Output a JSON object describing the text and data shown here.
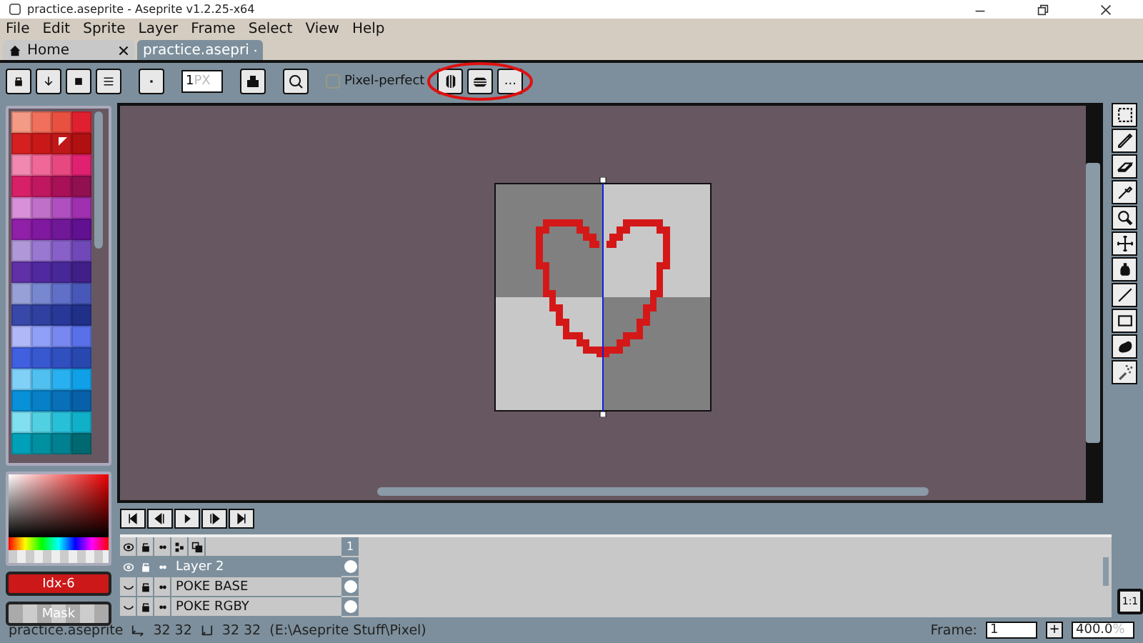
{
  "window": {
    "title": "practice.aseprite - Aseprite v1.2.25-x64"
  },
  "menu": [
    "File",
    "Edit",
    "Sprite",
    "Layer",
    "Frame",
    "Select",
    "View",
    "Help"
  ],
  "tabs": [
    {
      "label": "Home",
      "selected": false,
      "modified": false
    },
    {
      "label": "practice.asepri",
      "selected": true,
      "modified": true
    }
  ],
  "toolbar": {
    "brush_size": {
      "value": "1",
      "unit": "PX"
    },
    "pixel_perfect": {
      "label": "Pixel-perfect",
      "checked": false
    },
    "more": "..."
  },
  "palette": [
    {
      "color": "#f59a84",
      "selected": false
    },
    {
      "color": "#f0705c",
      "selected": false
    },
    {
      "color": "#e8503f",
      "selected": false
    },
    {
      "color": "#e02030",
      "selected": false
    },
    {
      "color": "#d42020",
      "selected": false
    },
    {
      "color": "#c81818",
      "selected": false
    },
    {
      "color": "#c01818",
      "selected": true
    },
    {
      "color": "#b01010",
      "selected": false
    },
    {
      "color": "#f088b0",
      "selected": false
    },
    {
      "color": "#f06898",
      "selected": false
    },
    {
      "color": "#e84880",
      "selected": false
    },
    {
      "color": "#e02070",
      "selected": false
    },
    {
      "color": "#d82068",
      "selected": false
    },
    {
      "color": "#c01860",
      "selected": false
    },
    {
      "color": "#a81058",
      "selected": false
    },
    {
      "color": "#901050",
      "selected": false
    },
    {
      "color": "#d890d8",
      "selected": false
    },
    {
      "color": "#c070c8",
      "selected": false
    },
    {
      "color": "#b050c0",
      "selected": false
    },
    {
      "color": "#a030b0",
      "selected": false
    },
    {
      "color": "#9020a8",
      "selected": false
    },
    {
      "color": "#8018a0",
      "selected": false
    },
    {
      "color": "#701898",
      "selected": false
    },
    {
      "color": "#601090",
      "selected": false
    },
    {
      "color": "#b098d8",
      "selected": false
    },
    {
      "color": "#9878d0",
      "selected": false
    },
    {
      "color": "#8860c8",
      "selected": false
    },
    {
      "color": "#7048b8",
      "selected": false
    },
    {
      "color": "#6030a8",
      "selected": false
    },
    {
      "color": "#5028a0",
      "selected": false
    },
    {
      "color": "#482898",
      "selected": false
    },
    {
      "color": "#402088",
      "selected": false
    },
    {
      "color": "#98a0d8",
      "selected": false
    },
    {
      "color": "#7888d0",
      "selected": false
    },
    {
      "color": "#6070c8",
      "selected": false
    },
    {
      "color": "#4858b8",
      "selected": false
    },
    {
      "color": "#3848a8",
      "selected": false
    },
    {
      "color": "#3040a0",
      "selected": false
    },
    {
      "color": "#283898",
      "selected": false
    },
    {
      "color": "#203088",
      "selected": false
    },
    {
      "color": "#b0b8f8",
      "selected": false
    },
    {
      "color": "#90a0f8",
      "selected": false
    },
    {
      "color": "#7888f0",
      "selected": false
    },
    {
      "color": "#5870e8",
      "selected": false
    },
    {
      "color": "#4060e0",
      "selected": false
    },
    {
      "color": "#3858d0",
      "selected": false
    },
    {
      "color": "#3050c0",
      "selected": false
    },
    {
      "color": "#2848b0",
      "selected": false
    },
    {
      "color": "#80d0f8",
      "selected": false
    },
    {
      "color": "#50c0f0",
      "selected": false
    },
    {
      "color": "#28b0f0",
      "selected": false
    },
    {
      "color": "#10a0e8",
      "selected": false
    },
    {
      "color": "#0890d8",
      "selected": false
    },
    {
      "color": "#0880c8",
      "selected": false
    },
    {
      "color": "#0870b8",
      "selected": false
    },
    {
      "color": "#0860a8",
      "selected": false
    },
    {
      "color": "#80e0f0",
      "selected": false
    },
    {
      "color": "#50d0e0",
      "selected": false
    },
    {
      "color": "#28c0d8",
      "selected": false
    },
    {
      "color": "#10b0c8",
      "selected": false
    },
    {
      "color": "#00a0b8",
      "selected": false
    },
    {
      "color": "#0090a0",
      "selected": false
    },
    {
      "color": "#008090",
      "selected": false
    },
    {
      "color": "#006870",
      "selected": false
    }
  ],
  "color_index": "Idx-6",
  "mask": "Mask",
  "timeline": {
    "frames": [
      "1"
    ],
    "layers": [
      {
        "name": "Layer 2",
        "visible": true,
        "selected": true
      },
      {
        "name": "POKE BASE",
        "visible": false,
        "selected": false
      },
      {
        "name": "POKE RGBY",
        "visible": false,
        "selected": false
      }
    ]
  },
  "zoom_reset": "1:1",
  "status": {
    "filename": "practice.aseprite",
    "size": "32 32",
    "grid": "32 32",
    "path": "(E:\\Aseprite Stuff\\Pixel)",
    "frame_label": "Frame:",
    "frame_value": "1",
    "add": "+",
    "zoom": "400.0",
    "zoom_unit": "%"
  }
}
